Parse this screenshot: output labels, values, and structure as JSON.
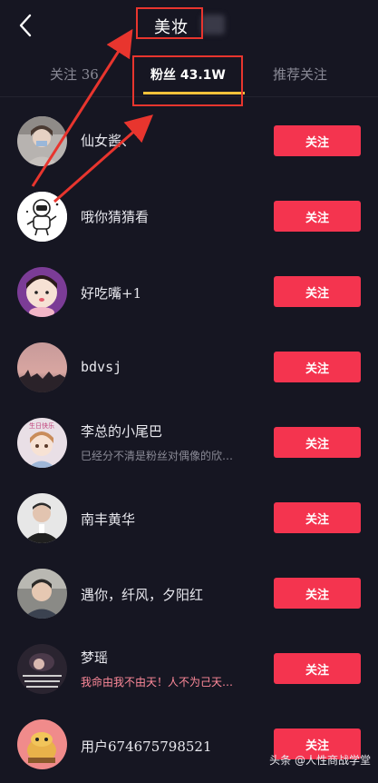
{
  "header": {
    "title": "美妆"
  },
  "tabs": [
    {
      "label": "关注 36"
    },
    {
      "label": "粉丝  43.1W"
    },
    {
      "label": "推荐关注"
    }
  ],
  "follow_label": "关注",
  "rows": [
    {
      "name": "仙女酱、",
      "sub": ""
    },
    {
      "name": "哦你猜猜看",
      "sub": ""
    },
    {
      "name": "好吃嘴+1",
      "sub": ""
    },
    {
      "name": "bdvsj",
      "sub": ""
    },
    {
      "name": "李总的小尾巴",
      "sub": "巳经分不清是粉丝对偶像的欣…",
      "avatar_text": "生日快乐"
    },
    {
      "name": "南丰黄华",
      "sub": ""
    },
    {
      "name": "遇你，纤风，夕阳红",
      "sub": ""
    },
    {
      "name": "梦瑶",
      "sub": "我命由我不由天！人不为己天…"
    },
    {
      "name": "用户674675798521",
      "sub": ""
    }
  ],
  "watermark": "头条 @人性商战学堂",
  "colors": {
    "background": "#161622",
    "follow_button": "#f4344f",
    "tab_underline": "#f7c23a",
    "annotation": "#e8352e"
  }
}
